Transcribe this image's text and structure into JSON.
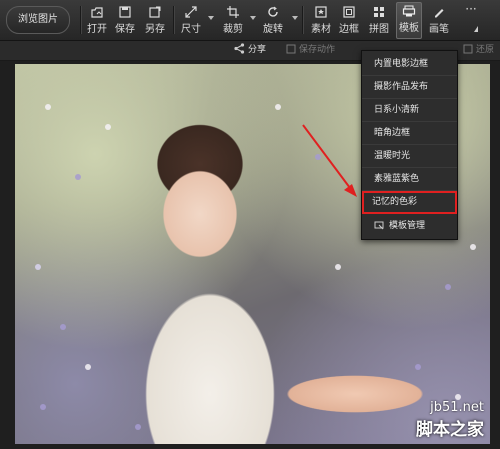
{
  "toolbar": {
    "browse_label": "浏览图片",
    "items": [
      {
        "label": "打开",
        "icon": "open-icon"
      },
      {
        "label": "保存",
        "icon": "save-icon"
      },
      {
        "label": "另存",
        "icon": "save-as-icon"
      },
      {
        "label": "尺寸",
        "icon": "resize-icon"
      },
      {
        "label": "裁剪",
        "icon": "crop-icon"
      },
      {
        "label": "旋转",
        "icon": "rotate-icon"
      },
      {
        "label": "素材",
        "icon": "sticker-icon"
      },
      {
        "label": "边框",
        "icon": "frame-icon"
      },
      {
        "label": "拼图",
        "icon": "collage-icon"
      },
      {
        "label": "模板",
        "icon": "template-icon"
      },
      {
        "label": "画笔",
        "icon": "brush-icon"
      }
    ],
    "more_label": "···"
  },
  "subbar": {
    "share_label": "分享",
    "save_action_label": "保存动作",
    "back_label": "还原"
  },
  "template_menu": {
    "items": [
      {
        "label": "内置电影边框"
      },
      {
        "label": "摄影作品发布"
      },
      {
        "label": "日系小清新"
      },
      {
        "label": "暗角边框"
      },
      {
        "label": "温暖时光"
      },
      {
        "label": "素雅蓝紫色"
      },
      {
        "label": "记忆的色彩"
      },
      {
        "label": "模板管理"
      }
    ],
    "highlighted_index": 6
  },
  "watermark": {
    "site": "jb51.net",
    "brand": "脚本之家"
  },
  "colors": {
    "highlight_red": "#e02020",
    "annotation_arrow": "#e02020"
  }
}
